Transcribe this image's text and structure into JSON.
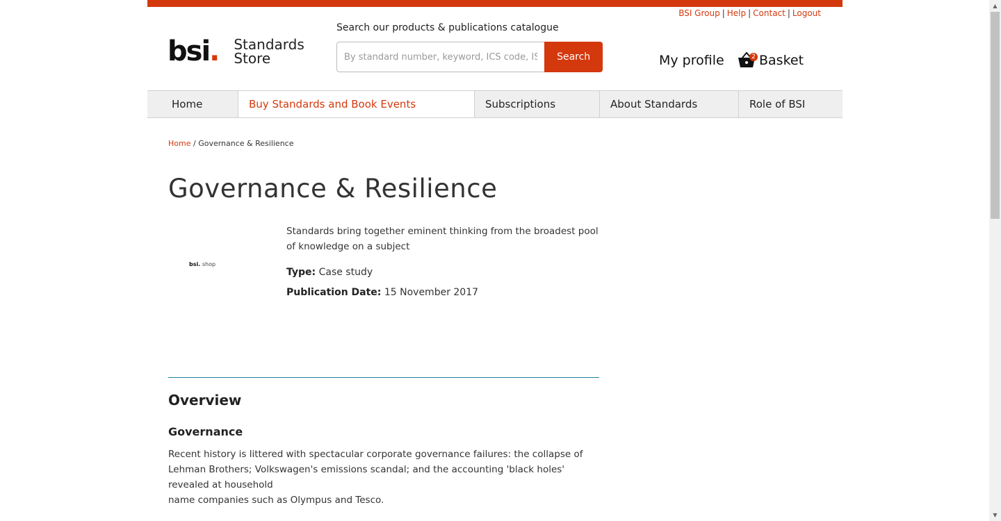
{
  "colors": {
    "brand": "#d4380d",
    "divider": "#1a7fa0"
  },
  "utility_links": [
    "BSI Group",
    "Help",
    "Contact",
    "Logout"
  ],
  "logo": {
    "wordmark": "bsi",
    "dot": ".",
    "line1": "Standards",
    "line2": "Store"
  },
  "search": {
    "title": "Search our products & publications catalogue",
    "placeholder": "By standard number, keyword, ICS code, ISBN",
    "button": "Search"
  },
  "header": {
    "profile": "My profile",
    "basket_label": "Basket",
    "basket_count": "2",
    "basket_icon": "basket-icon"
  },
  "nav": [
    {
      "label": "Home"
    },
    {
      "label": "Buy Standards and Book Events"
    },
    {
      "label": "Subscriptions"
    },
    {
      "label": "About Standards"
    },
    {
      "label": "Role of BSI"
    }
  ],
  "breadcrumb": {
    "home": "Home",
    "separator": " / ",
    "current": "Governance & Resilience"
  },
  "product": {
    "title": "Governance & Resilience",
    "thumb_bsi": "bsi.",
    "thumb_shop": "shop",
    "description": "Standards bring together eminent thinking from the broadest pool of knowledge on a subject",
    "type_label": "Type:",
    "type_value": "Case study",
    "date_label": "Publication Date:",
    "date_value": "15 November 2017"
  },
  "overview": {
    "heading": "Overview",
    "subheading": "Governance",
    "para_line1": "Recent history is littered with spectacular corporate governance failures: the collapse of Lehman Brothers; Volkswagen's emissions scandal; and the accounting 'black holes' revealed at household",
    "para_line2": "name companies such as Olympus and Tesco."
  }
}
